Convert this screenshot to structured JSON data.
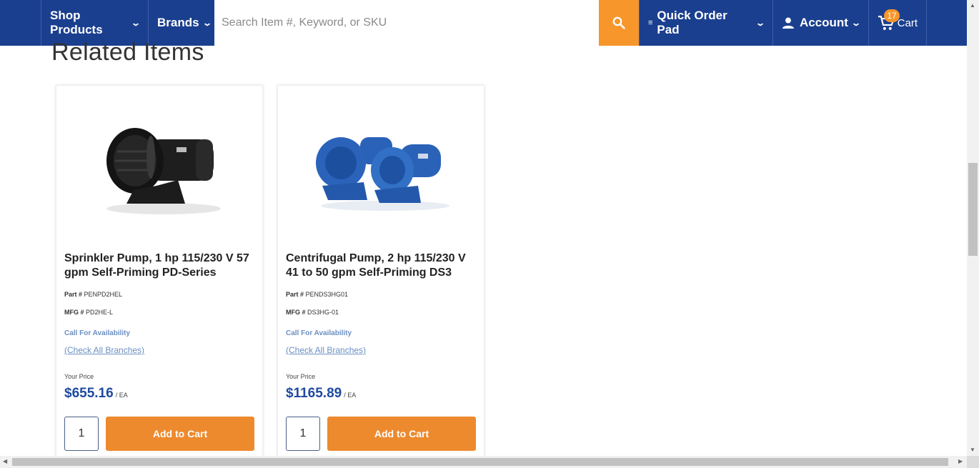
{
  "nav": {
    "shop_products": "Shop Products",
    "brands": "Brands",
    "search_placeholder": "Search Item #, Keyword, or SKU",
    "quick_order_pad": "Quick Order Pad",
    "account": "Account",
    "cart": "Cart",
    "cart_count": "17"
  },
  "section": {
    "title": "Related Items"
  },
  "products": [
    {
      "title": "Sprinkler Pump, 1 hp 115/230 V 57 gpm Self-Priming PD-Series",
      "part_label": "Part #",
      "part": "PENPD2HEL",
      "mfg_label": "MFG #",
      "mfg": "PD2HE-L",
      "availability": "Call For Availability",
      "branches": "(Check All Branches)",
      "price_label": "Your Price",
      "price": "$655.16",
      "unit": "/ EA",
      "qty": "1",
      "add_to_cart": "Add to Cart"
    },
    {
      "title": "Centrifugal Pump, 2 hp 115/230 V 41 to 50 gpm Self-Priming DS3",
      "part_label": "Part #",
      "part": "PENDS3HG01",
      "mfg_label": "MFG #",
      "mfg": "DS3HG-01",
      "availability": "Call For Availability",
      "branches": "(Check All Branches)",
      "price_label": "Your Price",
      "price": "$1165.89",
      "unit": "/ EA",
      "qty": "1",
      "add_to_cart": "Add to Cart"
    }
  ],
  "colors": {
    "nav_bg": "#1b3f8f",
    "accent_orange": "#f7962a",
    "button_orange": "#ed8a2e",
    "price_blue": "#1f4aa0",
    "link_blue": "#6b8fc2"
  },
  "icons": [
    "search-icon",
    "chevron-down-icon",
    "list-icon",
    "user-icon",
    "cart-icon"
  ]
}
